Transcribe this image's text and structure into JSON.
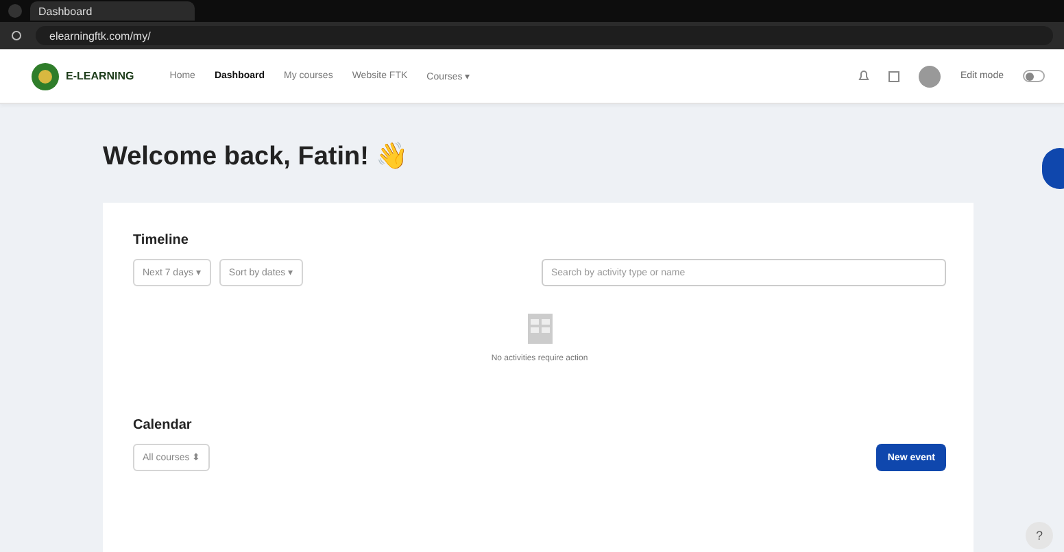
{
  "browser": {
    "tab_title": "Dashboard",
    "url": "elearningftk.com/my/"
  },
  "site": {
    "logo_title": "E-LEARNING",
    "nav": [
      {
        "label": "Home",
        "selected": false
      },
      {
        "label": "Dashboard",
        "selected": true
      },
      {
        "label": "My courses",
        "selected": false
      },
      {
        "label": "Website FTK",
        "selected": false
      },
      {
        "label": "Courses ▾",
        "selected": false
      }
    ],
    "edit_mode": {
      "label": "Edit mode",
      "on": false
    }
  },
  "welcome": "Welcome back, Fatin! 👋",
  "timeline": {
    "title": "Timeline",
    "filters": [
      "Next 7 days ▾",
      "Sort by dates ▾"
    ],
    "search": {
      "placeholder": "Search by activity type or name"
    },
    "empty": "No activities require action"
  },
  "calendar": {
    "title": "Calendar",
    "filter": "All courses ⬍",
    "new_event": "New event"
  },
  "help": "?"
}
